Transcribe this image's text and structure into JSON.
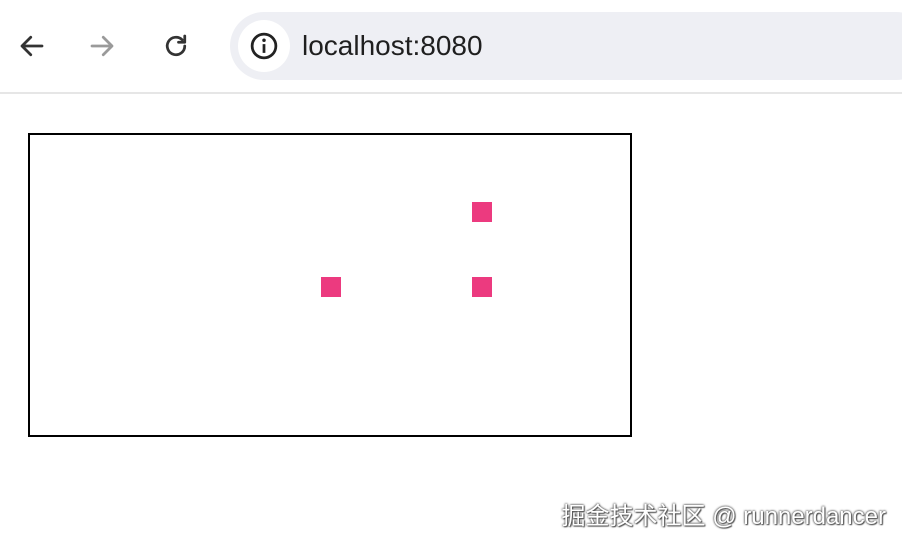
{
  "browser": {
    "back_icon": "arrow-left-icon",
    "forward_icon": "arrow-right-icon",
    "reload_icon": "reload-icon",
    "site_info_icon": "info-circle-icon",
    "url": "localhost:8080"
  },
  "canvas": {
    "square_color": "#ec3a7f",
    "border_color": "#000000"
  },
  "watermark": "掘金技术社区 @ runnerdancer"
}
